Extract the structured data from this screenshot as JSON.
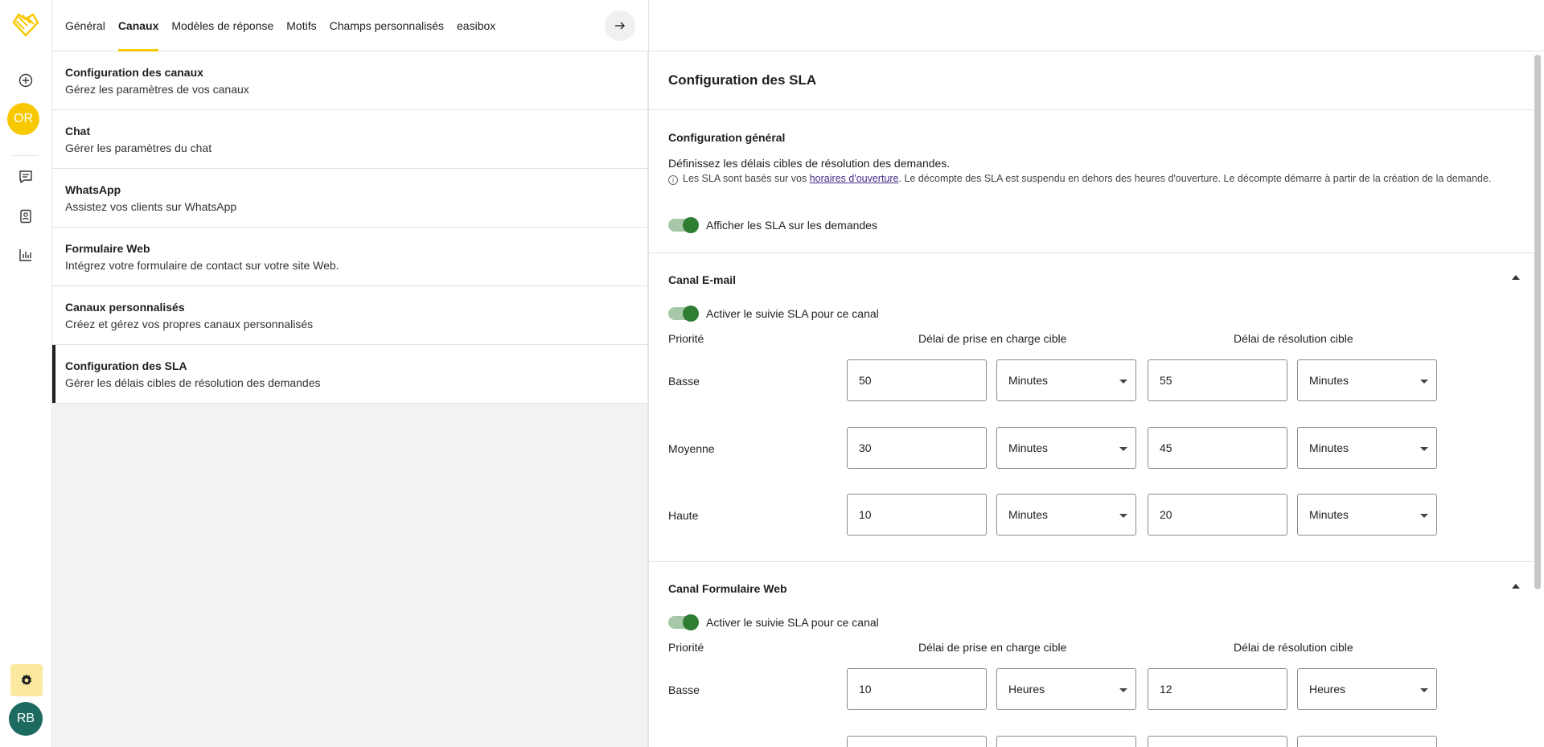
{
  "rail": {
    "avatar_initials": "OR",
    "user_initials": "RB"
  },
  "tabs": [
    {
      "label": "Général"
    },
    {
      "label": "Canaux"
    },
    {
      "label": "Modèles de réponse"
    },
    {
      "label": "Motifs"
    },
    {
      "label": "Champs personnalisés"
    },
    {
      "label": "easibox"
    }
  ],
  "active_tab": "Canaux",
  "list": [
    {
      "title": "Configuration des canaux",
      "subtitle": "Gérez les paramètres de vos canaux"
    },
    {
      "title": "Chat",
      "subtitle": "Gérer les paramètres du chat"
    },
    {
      "title": "WhatsApp",
      "subtitle": "Assistez vos clients sur WhatsApp"
    },
    {
      "title": "Formulaire Web",
      "subtitle": "Intégrez votre formulaire de contact sur votre site Web."
    },
    {
      "title": "Canaux personnalisés",
      "subtitle": "Créez et gérez vos propres canaux personnalisés"
    },
    {
      "title": "Configuration des SLA",
      "subtitle": "Gérer les délais cibles de résolution des demandes"
    }
  ],
  "detail": {
    "title": "Configuration des SLA",
    "general": {
      "title": "Configuration général",
      "description": "Définissez les délais cibles de résolution des demandes.",
      "info_before": "Les SLA sont basés sur vos ",
      "info_link": "horaires d'ouverture",
      "info_after": ". Le décompte des SLA est suspendu en dehors des heures d'ouverture. Le décompte démarre à partir de la création de la demande.",
      "toggle_label": "Afficher les SLA sur les demandes"
    },
    "columns": {
      "priority": "Priorité",
      "response": "Délai de prise en charge cible",
      "resolution": "Délai de résolution cible"
    },
    "email": {
      "title": "Canal E-mail",
      "toggle_label": "Activer le suivie SLA pour ce canal",
      "rows": [
        {
          "label": "Basse",
          "response_value": "50",
          "response_unit": "Minutes",
          "resolution_value": "55",
          "resolution_unit": "Minutes"
        },
        {
          "label": "Moyenne",
          "response_value": "30",
          "response_unit": "Minutes",
          "resolution_value": "45",
          "resolution_unit": "Minutes"
        },
        {
          "label": "Haute",
          "response_value": "10",
          "response_unit": "Minutes",
          "resolution_value": "20",
          "resolution_unit": "Minutes"
        }
      ]
    },
    "web": {
      "title": "Canal Formulaire Web",
      "toggle_label": "Activer le suivie SLA pour ce canal",
      "rows": [
        {
          "label": "Basse",
          "response_value": "10",
          "response_unit": "Heures",
          "resolution_value": "12",
          "resolution_unit": "Heures"
        }
      ]
    }
  }
}
